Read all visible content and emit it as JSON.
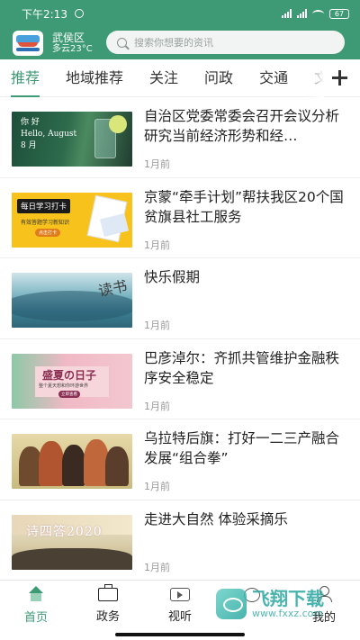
{
  "status_bar": {
    "time": "下午2:13",
    "battery": "67"
  },
  "header": {
    "location": "武侯区",
    "weather": "多云23°C",
    "search_placeholder": "搜索你想要的资讯"
  },
  "tabs": [
    "推荐",
    "地域推荐",
    "关注",
    "问政",
    "交通",
    "文旅"
  ],
  "news": [
    {
      "title": "自治区党委常委会召开会议分析研究当前经济形势和经…",
      "time": "1月前"
    },
    {
      "title": "京蒙“牵手计划”帮扶我区20个国贫旗县社工服务",
      "time": "1月前"
    },
    {
      "title": "快乐假期",
      "time": "1月前"
    },
    {
      "title": "巴彦淖尔：齐抓共管维护金融秩序安全稳定",
      "time": "1月前"
    },
    {
      "title": "乌拉特后旗：打好一二三产融合发展“组合拳”",
      "time": "1月前"
    },
    {
      "title": "走进大自然  体验采摘乐",
      "time": "1月前"
    }
  ],
  "thumbs": {
    "t1": {
      "line1": "你  好",
      "line2": "Hello, August",
      "line3": "8    月"
    },
    "t2": {
      "label": "每日学习打卡",
      "sub": "有效答题学习新知识",
      "btn": "点击打卡"
    },
    "t3": {
      "mark": "读书"
    },
    "t4": {
      "big": "盛夏の日子",
      "sub": "整个夏天想和你环游世界",
      "btn": "立即查看"
    },
    "t6": {
      "text": "诗四答2020"
    }
  },
  "bottom_nav": [
    {
      "label": "首页",
      "icon": "home-icon"
    },
    {
      "label": "政务",
      "icon": "briefcase-icon"
    },
    {
      "label": "视听",
      "icon": "video-icon"
    },
    {
      "label": "",
      "icon": "chat-icon"
    },
    {
      "label": "我的",
      "icon": "user-icon"
    }
  ],
  "watermark": {
    "name": "飞翔下载",
    "url": "www.fxxz.com"
  },
  "colors": {
    "brand": "#3e9a75",
    "text": "#222222",
    "muted": "#999999"
  }
}
